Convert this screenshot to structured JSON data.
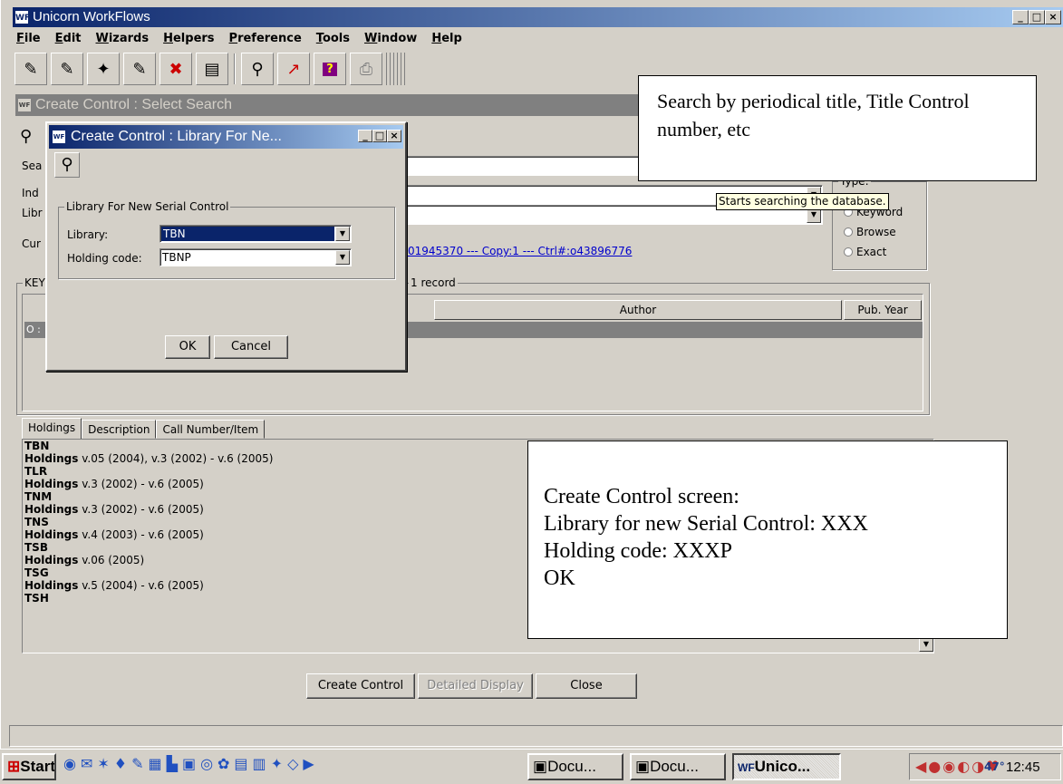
{
  "window": {
    "title": "Unicorn WorkFlows",
    "app_icon": "WF",
    "controls": [
      "_",
      "□",
      "×"
    ]
  },
  "menu": [
    "File",
    "Edit",
    "Wizards",
    "Helpers",
    "Preference",
    "Tools",
    "Window",
    "Help"
  ],
  "toolbar": {
    "icons": [
      "checkout-icon",
      "discharge-icon",
      "renew-icon",
      "checkin-icon",
      "cancel-icon",
      "display-icon",
      "binocular-icon",
      "chart-icon",
      "help-icon",
      "print-icon"
    ]
  },
  "inner": {
    "title": "Create Control : Select Search",
    "labels": {
      "search": "Sea",
      "index": "Ind",
      "library": "Libr",
      "current": "Cur",
      "results": "KEY"
    },
    "current_link": "01945370 --- Copy:1 --- Ctrl#:o43896776",
    "results_count": "1 record",
    "type_group": "Type:",
    "type_options": [
      "Keyword",
      "Browse",
      "Exact"
    ],
    "tooltip": "Starts searching the database.",
    "columns": [
      "Author",
      "Pub. Year"
    ],
    "selected_row_prefix": "O :"
  },
  "tabs": [
    "Holdings",
    "Description",
    "Call Number/Item"
  ],
  "holdings": [
    {
      "lib": "TBN",
      "label": "Holdings",
      "value": "v.05 (2004), v.3 (2002) - v.6 (2005)"
    },
    {
      "lib": "TLR",
      "label": "Holdings",
      "value": "v.3 (2002) - v.6 (2005)"
    },
    {
      "lib": "TNM",
      "label": "Holdings",
      "value": "v.3 (2002) - v.6 (2005)"
    },
    {
      "lib": "TNS",
      "label": "Holdings",
      "value": "v.4 (2003) - v.6 (2005)"
    },
    {
      "lib": "TSB",
      "label": "Holdings",
      "value": "v.06 (2005)"
    },
    {
      "lib": "TSG",
      "label": "Holdings",
      "value": "v.5 (2004) - v.6 (2005)"
    },
    {
      "lib": "TSH",
      "label": "",
      "value": ""
    }
  ],
  "bottom_buttons": {
    "create": "Create Control",
    "detail": "Detailed Display",
    "close": "Close"
  },
  "dialog": {
    "title": "Create Control : Library For Ne...",
    "group": "Library For New Serial Control",
    "library_label": "Library:",
    "library_value": "TBN",
    "holding_label": "Holding code:",
    "holding_value": "TBNP",
    "ok": "OK",
    "cancel": "Cancel"
  },
  "callouts": {
    "search": "Search by periodical title, Title Control number, etc",
    "create_lines": [
      "Create Control screen:",
      "Library for new Serial Control: XXX",
      "Holding code: XXXP",
      "OK"
    ]
  },
  "taskbar": {
    "start": "Start",
    "tasks": [
      "Docu...",
      "Docu...",
      "Unico..."
    ],
    "tray_temp": "47°",
    "clock": "12:45 PM"
  },
  "colors": {
    "titlebar": "#0a246a",
    "face": "#d4d0c8",
    "selection": "#0a246a",
    "link": "#0000cc"
  }
}
